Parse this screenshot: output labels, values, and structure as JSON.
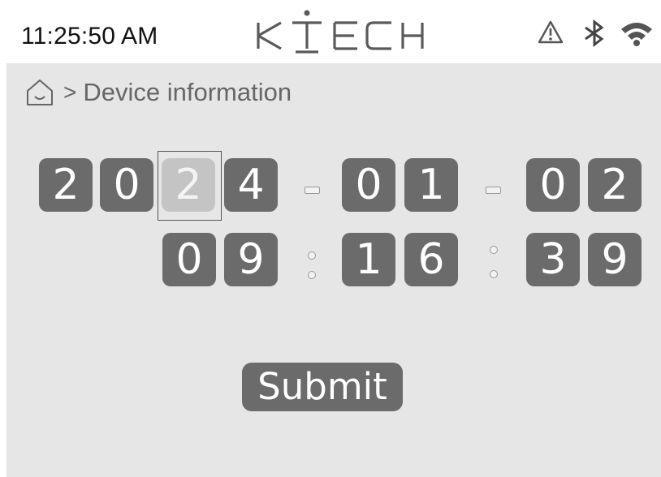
{
  "status_bar": {
    "time": "11:25:50 AM",
    "brand": "KTECH",
    "icons": [
      "warning-icon",
      "bluetooth-icon",
      "wifi-icon"
    ]
  },
  "breadcrumb": {
    "home_icon": "home-icon",
    "separator": ">",
    "current": "Device information"
  },
  "datetime": {
    "year": [
      "2",
      "0",
      "2",
      "4"
    ],
    "month": [
      "0",
      "1"
    ],
    "day": [
      "0",
      "2"
    ],
    "hour": [
      "0",
      "9"
    ],
    "minute": [
      "1",
      "6"
    ],
    "second": [
      "3",
      "9"
    ],
    "selected_digit": "year.2"
  },
  "actions": {
    "submit_label": "Submit"
  },
  "colors": {
    "digit_bg": "#6b6b6b",
    "digit_selected_bg": "#c4c4c4",
    "panel_bg": "#e6e6e6"
  }
}
